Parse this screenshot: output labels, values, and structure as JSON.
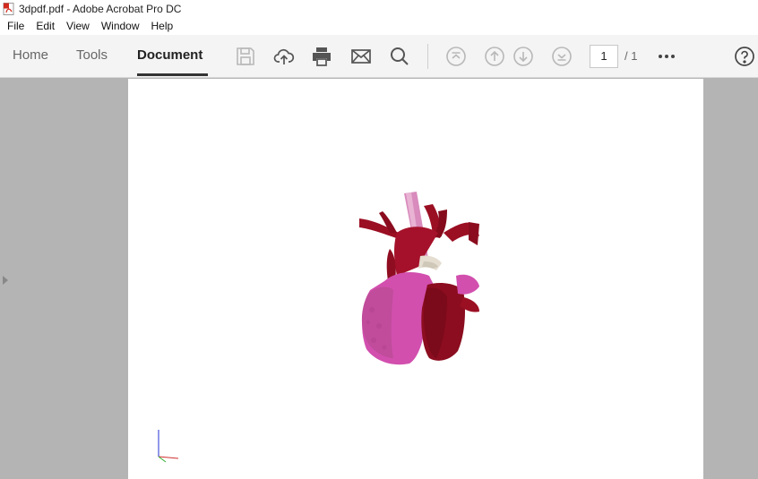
{
  "window": {
    "title": "3dpdf.pdf - Adobe Acrobat Pro DC"
  },
  "menu": [
    "File",
    "Edit",
    "View",
    "Window",
    "Help"
  ],
  "tabs": {
    "home": "Home",
    "tools": "Tools",
    "document": "Document"
  },
  "pager": {
    "current": "1",
    "total": "/ 1"
  },
  "icons": {
    "save": "save-icon",
    "upload": "cloud-upload-icon",
    "print": "print-icon",
    "email": "envelope-icon",
    "search": "search-icon",
    "first": "first-page-icon",
    "prev": "arrow-up-icon",
    "next": "arrow-down-icon",
    "last": "last-page-icon",
    "more": "more-icon",
    "help": "help-icon"
  },
  "colors": {
    "toolbar_bg": "#f4f4f4",
    "canvas_bg": "#b4b4b4",
    "heart_dark": "#8b0d1f",
    "heart_pink": "#d24fae",
    "aorta": "#d88bbc"
  }
}
